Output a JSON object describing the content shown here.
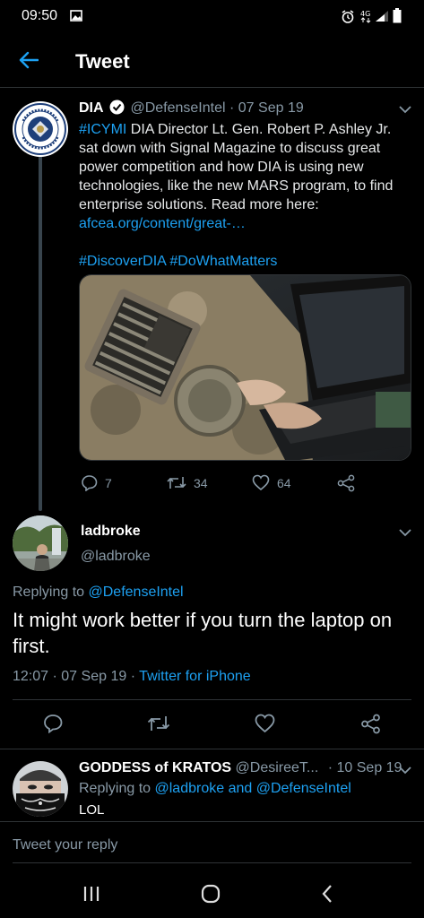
{
  "status_bar": {
    "time": "09:50"
  },
  "header": {
    "title": "Tweet"
  },
  "tweet": {
    "author_name": "DIA",
    "handle": "@DefenseIntel",
    "separator": "·",
    "date": "07 Sep 19",
    "hashtag_icymi": "#ICYMI",
    "body": " DIA Director Lt. Gen. Robert P. Ashley Jr. sat down with Signal Magazine to discuss great power competition and how DIA is using new technologies, like the new MARS program, to find enterprise solutions. Read more here: ",
    "link": "afcea.org/content/great-…",
    "hashtag_discover": "#DiscoverDIA",
    "hashtag_dowhat": "#DoWhatMatters",
    "replies": "7",
    "retweets": "34",
    "likes": "64"
  },
  "reply": {
    "name": "ladbroke",
    "handle": "@ladbroke",
    "replying_prefix": "Replying to ",
    "replying_to": "@DefenseIntel",
    "text": "It might work better if you turn the laptop on first.",
    "time": "12:07",
    "separator": "·",
    "date": "07 Sep 19",
    "separator2": "·",
    "source": "Twitter for iPhone"
  },
  "next_reply": {
    "name": "GODDESS of KRATOS",
    "handle": "@DesireeT...",
    "separator": "·",
    "date": "10 Sep 19",
    "replying_prefix": "Replying to ",
    "replying_to": "@ladbroke and @DefenseIntel",
    "text": "LOL"
  },
  "compose": {
    "placeholder": "Tweet your reply"
  },
  "colors": {
    "accent": "#1da1f2",
    "background": "#000000",
    "muted": "#8899a6"
  }
}
